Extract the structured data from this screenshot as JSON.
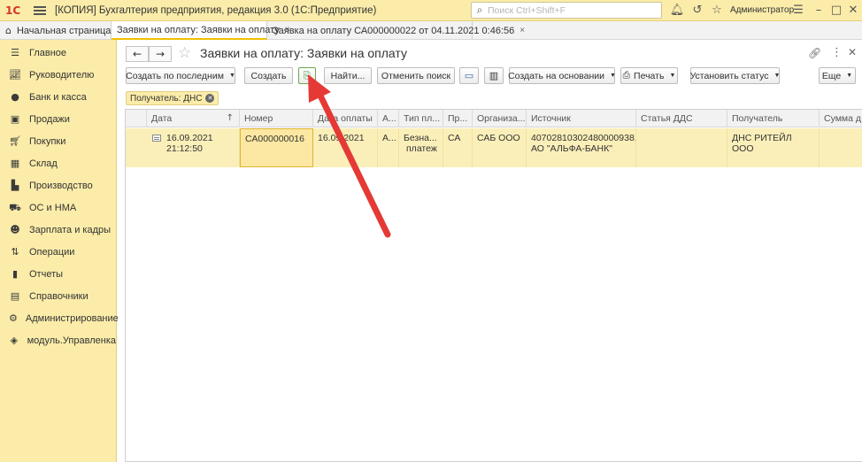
{
  "app": {
    "logo_text": "1С",
    "title": "[КОПИЯ] Бухгалтерия предприятия, редакция 3.0  (1С:Предприятие)",
    "search_placeholder": "Поиск Ctrl+Shift+F",
    "user": "Администратор"
  },
  "tabs": [
    {
      "label": "Начальная страница"
    },
    {
      "label": "Заявки на оплату: Заявки на оплату"
    },
    {
      "label": "Заявка на оплату СА000000022 от 04.11.2021 0:46:56"
    }
  ],
  "sidebar": {
    "items": [
      {
        "label": "Главное",
        "icon": "menu-icon"
      },
      {
        "label": "Руководителю",
        "icon": "chart-icon"
      },
      {
        "label": "Банк и касса",
        "icon": "coin-icon"
      },
      {
        "label": "Продажи",
        "icon": "bag-icon"
      },
      {
        "label": "Покупки",
        "icon": "cart-icon"
      },
      {
        "label": "Склад",
        "icon": "warehouse-icon"
      },
      {
        "label": "Производство",
        "icon": "factory-icon"
      },
      {
        "label": "ОС и НМА",
        "icon": "truck-icon"
      },
      {
        "label": "Зарплата и кадры",
        "icon": "people-icon"
      },
      {
        "label": "Операции",
        "icon": "operations-icon"
      },
      {
        "label": "Отчеты",
        "icon": "report-icon"
      },
      {
        "label": "Справочники",
        "icon": "books-icon"
      },
      {
        "label": "Администрирование",
        "icon": "gear-icon"
      },
      {
        "label": "модуль.Управленка",
        "icon": "module-icon"
      }
    ]
  },
  "page": {
    "title": "Заявки на оплату: Заявки на оплату"
  },
  "toolbar": {
    "create_by_last": "Создать по последним",
    "create": "Создать",
    "find": "Найти...",
    "cancel_search": "Отменить поиск",
    "create_based_on": "Создать на основании",
    "print": "Печать",
    "set_status": "Установить статус",
    "more": "Еще"
  },
  "filter": {
    "label": "Получатель: ДНС"
  },
  "table": {
    "columns": [
      "Дата",
      "Номер",
      "Дата оплаты",
      "А...",
      "Тип пл...",
      "Пр...",
      "Организа...",
      "Источник",
      "Статья ДДС",
      "Получатель",
      "Сумма д"
    ],
    "rows": [
      {
        "date": "16.09.2021",
        "time": "21:12:50",
        "number": "СА000000016",
        "pay_date": "16.09.2021",
        "a": "А...",
        "pay_type_1": "Безна...",
        "pay_type_2": "платеж",
        "pr": "СА",
        "org": "САБ ООО",
        "source_1": "40702810302480000938,",
        "source_2": "АО \"АЛЬФА-БАНК\"",
        "dds": "",
        "recipient": "ДНС РИТЕЙЛ ООО",
        "sum": ""
      }
    ]
  },
  "colors": {
    "accent_yellow": "#fbeca9",
    "selected_row": "#fbefb9",
    "annotation_arrow": "#e53935"
  }
}
